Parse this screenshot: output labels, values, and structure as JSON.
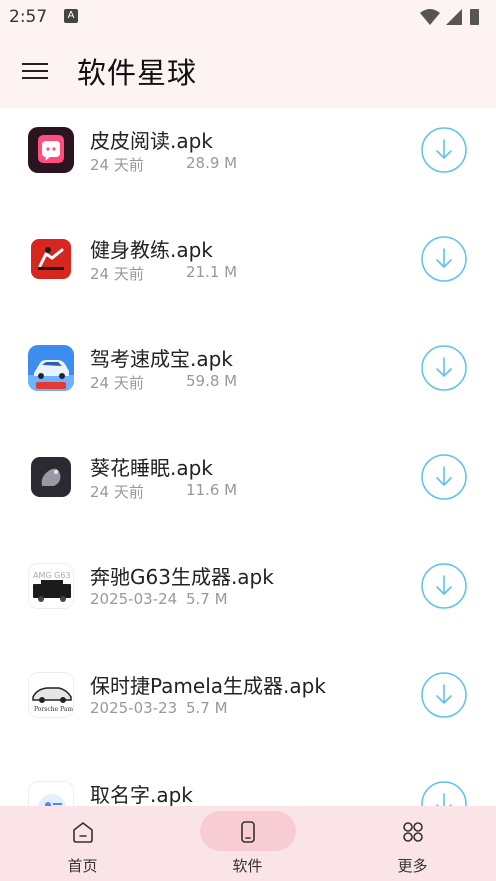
{
  "status": {
    "time": "2:57",
    "notif_icon": "A"
  },
  "appbar": {
    "title": "软件星球"
  },
  "files": [
    {
      "name": "皮皮阅读.apk",
      "date": "24 天前",
      "size": "28.9 M",
      "icon": "pipi-reader-app-icon"
    },
    {
      "name": "健身教练.apk",
      "date": "24 天前",
      "size": "21.1 M",
      "icon": "fitness-coach-app-icon"
    },
    {
      "name": "驾考速成宝.apk",
      "date": "24 天前",
      "size": "59.8 M",
      "icon": "driving-test-app-icon"
    },
    {
      "name": "葵花睡眠.apk",
      "date": "24 天前",
      "size": "11.6 M",
      "icon": "sunflower-sleep-app-icon"
    },
    {
      "name": "奔驰G63生成器.apk",
      "date": "2025-03-24",
      "size": "5.7 M",
      "icon": "benz-g63-app-icon"
    },
    {
      "name": "保时捷Pamela生成器.apk",
      "date": "2025-03-23",
      "size": "5.7 M",
      "icon": "porsche-pamela-app-icon"
    },
    {
      "name": "取名字.apk",
      "date": "",
      "size": "",
      "icon": "naming-app-icon"
    }
  ],
  "nav": [
    {
      "label": "首页",
      "icon": "home-icon"
    },
    {
      "label": "软件",
      "icon": "phone-icon",
      "active": true
    },
    {
      "label": "更多",
      "icon": "grid-icon"
    }
  ],
  "colors": {
    "accent": "#5ec3ef",
    "appbar": "#fdf3f3",
    "bottomnav": "#fbe4e7",
    "nav_pill": "#f7cdd3"
  }
}
